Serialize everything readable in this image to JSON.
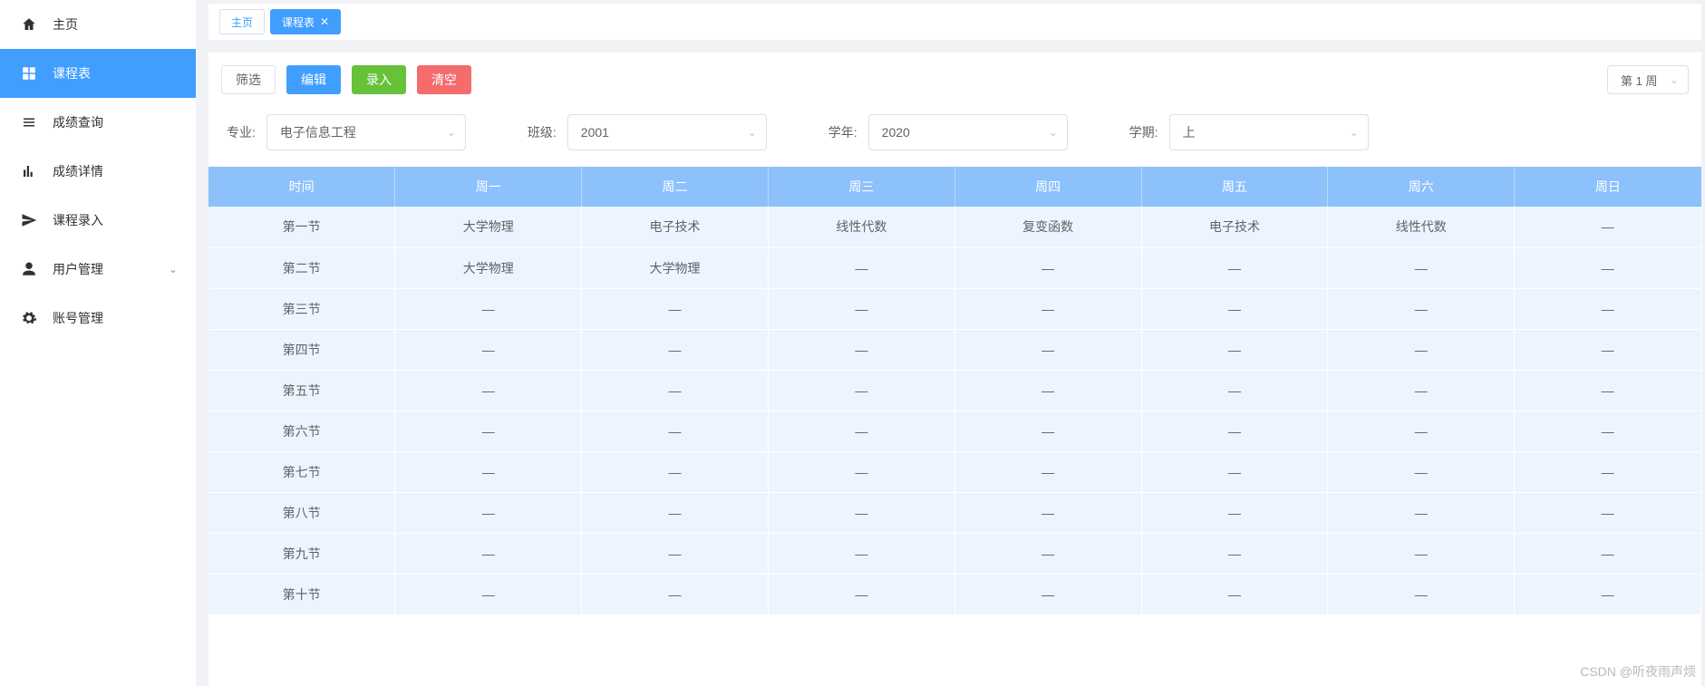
{
  "sidebar": {
    "items": [
      {
        "icon": "home",
        "label": "主页"
      },
      {
        "icon": "grid",
        "label": "课程表"
      },
      {
        "icon": "list",
        "label": "成绩查询"
      },
      {
        "icon": "bars",
        "label": "成绩详情"
      },
      {
        "icon": "send",
        "label": "课程录入"
      },
      {
        "icon": "user",
        "label": "用户管理",
        "expandable": true
      },
      {
        "icon": "gear",
        "label": "账号管理"
      }
    ],
    "active_index": 1
  },
  "tabs": {
    "items": [
      {
        "label": "主页",
        "closable": false
      },
      {
        "label": "课程表",
        "closable": true
      }
    ],
    "active_index": 1
  },
  "toolbar": {
    "filter": "筛选",
    "edit": "编辑",
    "entry": "录入",
    "clear": "清空",
    "week_value": "第 1 周"
  },
  "filters": {
    "major_label": "专业:",
    "major_value": "电子信息工程",
    "class_label": "班级:",
    "class_value": "2001",
    "year_label": "学年:",
    "year_value": "2020",
    "term_label": "学期:",
    "term_value": "上"
  },
  "table": {
    "headers": [
      "时间",
      "周一",
      "周二",
      "周三",
      "周四",
      "周五",
      "周六",
      "周日"
    ],
    "rows": [
      {
        "time": "第一节",
        "cells": [
          "大学物理",
          "电子技术",
          "线性代数",
          "复变函数",
          "电子技术",
          "线性代数",
          "—"
        ]
      },
      {
        "time": "第二节",
        "cells": [
          "大学物理",
          "大学物理",
          "—",
          "—",
          "—",
          "—",
          "—"
        ]
      },
      {
        "time": "第三节",
        "cells": [
          "—",
          "—",
          "—",
          "—",
          "—",
          "—",
          "—"
        ]
      },
      {
        "time": "第四节",
        "cells": [
          "—",
          "—",
          "—",
          "—",
          "—",
          "—",
          "—"
        ]
      },
      {
        "time": "第五节",
        "cells": [
          "—",
          "—",
          "—",
          "—",
          "—",
          "—",
          "—"
        ]
      },
      {
        "time": "第六节",
        "cells": [
          "—",
          "—",
          "—",
          "—",
          "—",
          "—",
          "—"
        ]
      },
      {
        "time": "第七节",
        "cells": [
          "—",
          "—",
          "—",
          "—",
          "—",
          "—",
          "—"
        ]
      },
      {
        "time": "第八节",
        "cells": [
          "—",
          "—",
          "—",
          "—",
          "—",
          "—",
          "—"
        ]
      },
      {
        "time": "第九节",
        "cells": [
          "—",
          "—",
          "—",
          "—",
          "—",
          "—",
          "—"
        ]
      },
      {
        "time": "第十节",
        "cells": [
          "—",
          "—",
          "—",
          "—",
          "—",
          "—",
          "—"
        ]
      }
    ]
  },
  "watermark": "CSDN @听夜雨声烦"
}
